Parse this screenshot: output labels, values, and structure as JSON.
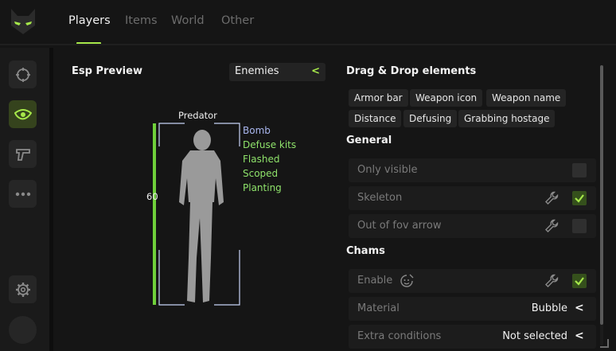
{
  "colors": {
    "accent": "#a6e84a",
    "flag_blue": "#a9b6ee",
    "flag_green": "#8fe36b",
    "health": "#6fd03a"
  },
  "nav": {
    "tabs": [
      {
        "label": "Players",
        "active": true
      },
      {
        "label": "Items"
      },
      {
        "label": "World"
      },
      {
        "label": "Other"
      }
    ]
  },
  "sidebar": {
    "icons": [
      "crosshair-icon",
      "eye-icon",
      "pistol-icon",
      "more-icon",
      "gear-icon"
    ],
    "active": "eye-icon"
  },
  "esp": {
    "title": "Esp Preview",
    "filter": {
      "selected": "Enemies",
      "chevron": "<"
    },
    "player_name": "Predator",
    "health": 60,
    "health_fraction": 1.0,
    "flags": [
      "Bomb",
      "Defuse kits",
      "Flashed",
      "Scoped",
      "Planting"
    ]
  },
  "dragdrop": {
    "title": "Drag & Drop elements",
    "chips": [
      "Armor bar",
      "Weapon icon",
      "Weapon name",
      "Distance",
      "Defusing",
      "Grabbing hostage"
    ]
  },
  "general": {
    "title": "General",
    "rows": [
      {
        "label": "Only visible",
        "checked": false
      },
      {
        "label": "Skeleton",
        "checked": true
      },
      {
        "label": "Out of fov arrow",
        "checked": false
      }
    ]
  },
  "chams": {
    "title": "Chams",
    "enable_label": "Enable",
    "enable_checked": true,
    "material_label": "Material",
    "material_value": "Bubble",
    "extra_label": "Extra conditions",
    "extra_value": "Not selected",
    "chevron": "<"
  }
}
